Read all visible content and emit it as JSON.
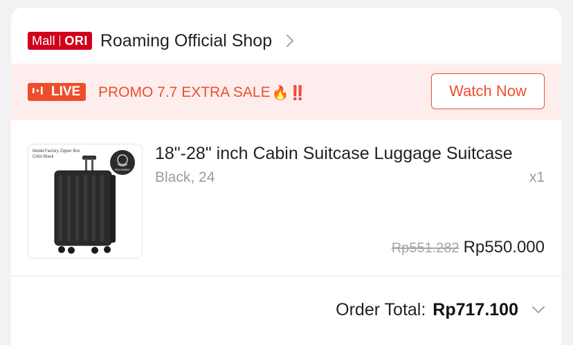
{
  "shop": {
    "badge_mall": "Mall",
    "badge_ori": "ORI",
    "name": "Roaming Official Shop"
  },
  "promo": {
    "live_label": "LIVE",
    "text": "PROMO 7.7 EXTRA SALE",
    "emoji": "🔥‼️",
    "watch_button": "Watch Now",
    "accent_color": "#ee4d2d"
  },
  "product": {
    "image_caption_line1": "Model:Factory Zipper Box",
    "image_caption_line2": "Color:Black",
    "image_logo_text": "ROAMING",
    "title": "18\"-28\" inch Cabin Suitcase Luggage Suitcase",
    "variant": "Black, 24",
    "quantity": "x1",
    "original_price": "Rp551.282",
    "price": "Rp550.000"
  },
  "order": {
    "total_label": "Order Total:",
    "total_value": "Rp717.100"
  }
}
